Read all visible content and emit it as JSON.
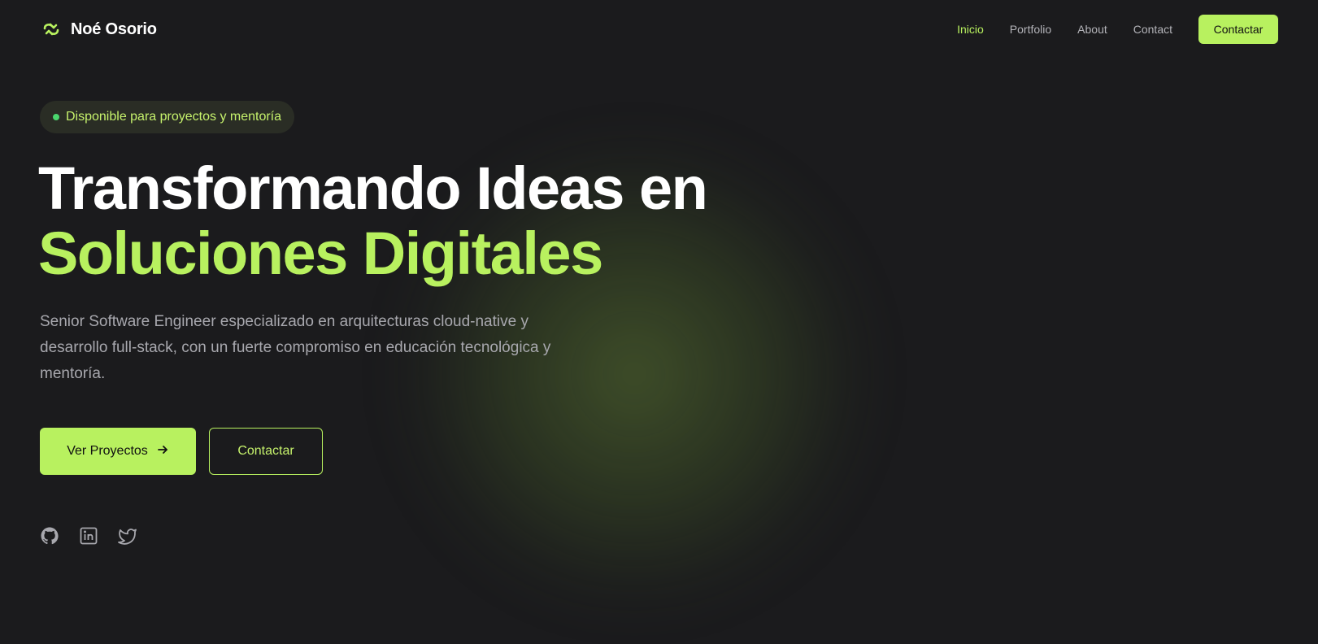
{
  "brand": {
    "name": "Noé Osorio",
    "icon": "refresh-arrows-icon"
  },
  "nav": {
    "links": [
      {
        "label": "Inicio",
        "active": true
      },
      {
        "label": "Portfolio",
        "active": false
      },
      {
        "label": "About",
        "active": false
      },
      {
        "label": "Contact",
        "active": false
      }
    ],
    "cta_label": "Contactar"
  },
  "hero": {
    "badge": "Disponible para proyectos y mentoría",
    "title_line1": "Transformando Ideas en",
    "title_line2": "Soluciones Digitales",
    "description": "Senior Software Engineer especializado en arquitecturas cloud-native y desarrollo full-stack, con un fuerte compromiso en educación tecnológica y mentoría.",
    "primary_button": "Ver Proyectos",
    "secondary_button": "Contactar"
  },
  "socials": [
    "github-icon",
    "linkedin-icon",
    "twitter-icon"
  ],
  "colors": {
    "accent": "#b8f15f",
    "background": "#1b1b1d",
    "status_dot": "#4ad66d"
  }
}
